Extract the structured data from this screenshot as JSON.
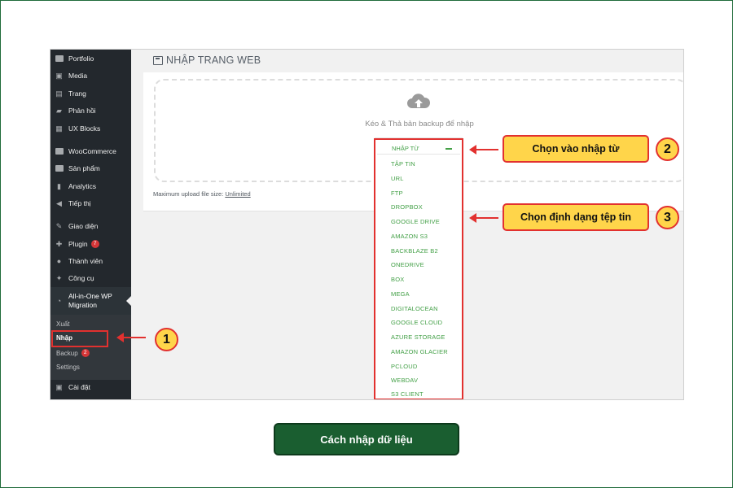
{
  "sidebar": {
    "items": [
      {
        "label": "Portfolio",
        "icon": "portfolio-icon"
      },
      {
        "label": "Media",
        "icon": "media-icon"
      },
      {
        "label": "Trang",
        "icon": "pages-icon"
      },
      {
        "label": "Phản hồi",
        "icon": "comments-icon"
      },
      {
        "label": "UX Blocks",
        "icon": "blocks-icon"
      },
      {
        "label": "WooCommerce",
        "icon": "woocommerce-icon"
      },
      {
        "label": "Sản phẩm",
        "icon": "products-icon"
      },
      {
        "label": "Analytics",
        "icon": "analytics-icon"
      },
      {
        "label": "Tiếp thị",
        "icon": "marketing-icon"
      },
      {
        "label": "Giao diện",
        "icon": "appearance-icon"
      },
      {
        "label": "Plugin",
        "icon": "plugin-icon",
        "badge": "7"
      },
      {
        "label": "Thành viên",
        "icon": "users-icon"
      },
      {
        "label": "Công cụ",
        "icon": "tools-icon"
      }
    ],
    "active_item": {
      "label_line1": "All-in-One WP",
      "label_line2": "Migration",
      "icon": "migration-icon"
    },
    "submenu": [
      {
        "label": "Xuất"
      },
      {
        "label": "Nhập"
      },
      {
        "label": "Backup",
        "badge": "2"
      },
      {
        "label": "Settings"
      }
    ],
    "bottom_item": {
      "label": "Cài đặt",
      "icon": "settings-icon"
    }
  },
  "main": {
    "title": "NHẬP TRANG WEB",
    "drop_text": "Kéo & Thả bản backup để nhập",
    "upload_note_prefix": "Maximum upload file size:",
    "upload_note_value": "Unlimited"
  },
  "dropdown": {
    "header": "NHẬP TỪ",
    "items": [
      "TẬP TIN",
      "URL",
      "FTP",
      "DROPBOX",
      "GOOGLE DRIVE",
      "AMAZON S3",
      "BACKBLAZE B2",
      "ONEDRIVE",
      "BOX",
      "MEGA",
      "DIGITALOCEAN",
      "GOOGLE CLOUD",
      "AZURE STORAGE",
      "AMAZON GLACIER",
      "PCLOUD",
      "WEBDAV",
      "S3 CLIENT"
    ]
  },
  "annotations": {
    "step1_number": "1",
    "step2_number": "2",
    "step2_text": "Chọn vào nhập từ",
    "step3_number": "3",
    "step3_text": "Chọn định dạng tệp tin"
  },
  "caption": "Cách nhập dữ liệu",
  "colors": {
    "accent_green": "#43a047",
    "highlight_red": "#e2312f",
    "callout_yellow": "#ffd54a",
    "caption_green": "#1a5e30",
    "sidebar_dark": "#23282d"
  }
}
